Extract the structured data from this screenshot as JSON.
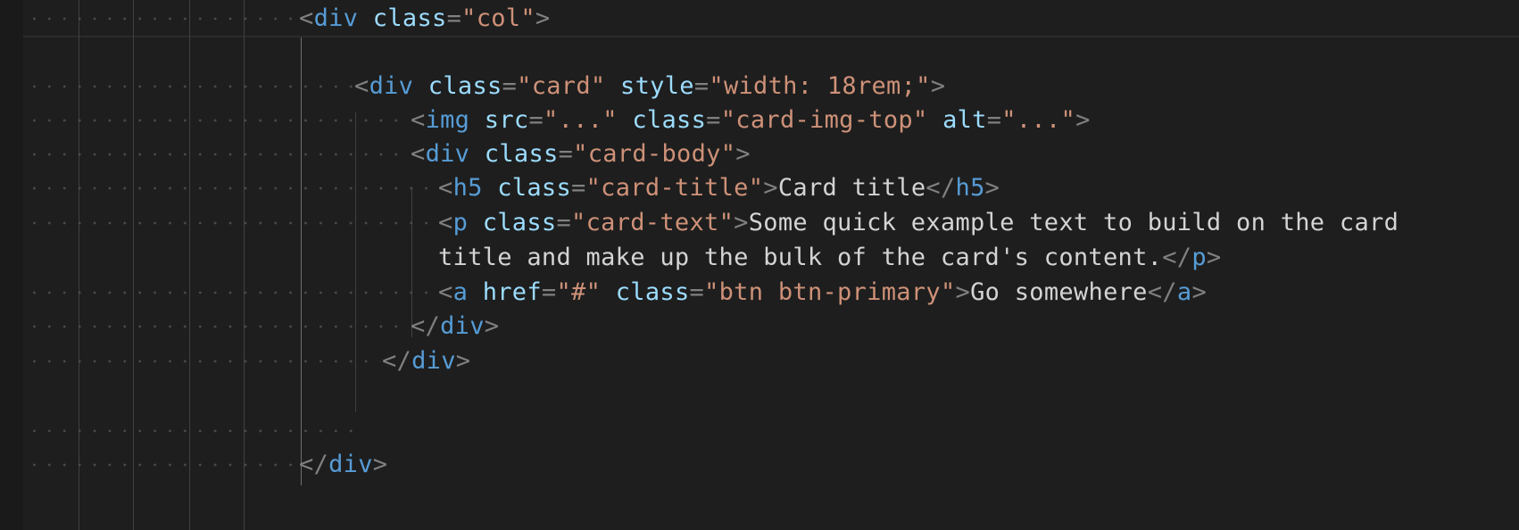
{
  "colors": {
    "background": "#1e1e1e",
    "tag": "#569cd6",
    "attribute": "#9cdcfe",
    "string": "#ce9178",
    "punctuation": "#808080",
    "text": "#d4d4d4"
  },
  "lines": {
    "l1": {
      "tag": "div",
      "attr": "class",
      "val": "\"col\""
    },
    "l3": {
      "tag": "div",
      "attr1": "class",
      "val1": "\"card\"",
      "attr2": "style",
      "val2": "\"width: 18rem;\""
    },
    "l4": {
      "tag": "img",
      "attr1": "src",
      "val1": "\"...\"",
      "attr2": "class",
      "val2": "\"card-img-top\"",
      "attr3": "alt",
      "val3": "\"...\""
    },
    "l5": {
      "tag": "div",
      "attr": "class",
      "val": "\"card-body\""
    },
    "l6": {
      "tag": "h5",
      "attr": "class",
      "val": "\"card-title\"",
      "text": "Card title",
      "close": "h5"
    },
    "l7": {
      "tag": "p",
      "attr": "class",
      "val": "\"card-text\"",
      "text": "Some quick example text to build on the card"
    },
    "l8": {
      "text": "title and make up the bulk of the card's content.",
      "close": "p"
    },
    "l9": {
      "tag": "a",
      "attr1": "href",
      "val1": "\"#\"",
      "attr2": "class",
      "val2": "\"btn btn-primary\"",
      "text": "Go somewhere",
      "close": "a"
    },
    "l10": {
      "close": "div"
    },
    "l11": {
      "close": "div"
    },
    "l14": {
      "close": "div"
    }
  }
}
